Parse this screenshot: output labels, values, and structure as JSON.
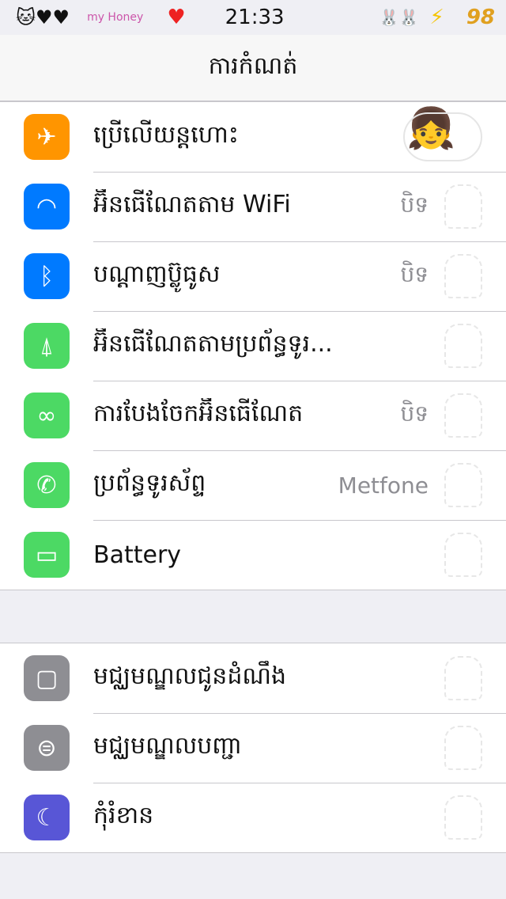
{
  "status": {
    "time": "21:33",
    "battery": "98",
    "sticker_text": "my Honey"
  },
  "header": {
    "title": "ការកំណត់"
  },
  "section1": [
    {
      "label": "ប្រើលើយន្តហោះ",
      "icon": "airplane-icon",
      "color": "#ff9500",
      "toggle": false
    },
    {
      "label": "អ៊ីនធើណែតតាម WiFi",
      "value": "បិទ",
      "icon": "wifi-icon",
      "color": "#007aff"
    },
    {
      "label": "បណ្តាញប៊្លូធូស",
      "value": "បិទ",
      "icon": "bluetooth-icon",
      "color": "#007aff"
    },
    {
      "label": "អ៊ីនធើណែតតាមប្រព័ន្ធទូរ...",
      "icon": "cellular-icon",
      "color": "#4cd964"
    },
    {
      "label": "ការបែងចែកអ៊ីនធើណែត",
      "value": "បិទ",
      "icon": "hotspot-icon",
      "color": "#4cd964"
    },
    {
      "label": "ប្រព័ន្ធទូរស័ព្ទ",
      "value": "Metfone",
      "icon": "phone-icon",
      "color": "#4cd964"
    },
    {
      "label": "Battery",
      "icon": "battery-icon",
      "color": "#4cd964"
    }
  ],
  "section2": [
    {
      "label": "មជ្ឈមណ្ឌលជូនដំណឹង",
      "icon": "notifications-icon",
      "color": "#8e8e93"
    },
    {
      "label": "មជ្ឈមណ្ឌលបញ្ជា",
      "icon": "control-center-icon",
      "color": "#8e8e93"
    },
    {
      "label": "កុំរំខាន",
      "icon": "moon-icon",
      "color": "#5856d6"
    }
  ]
}
